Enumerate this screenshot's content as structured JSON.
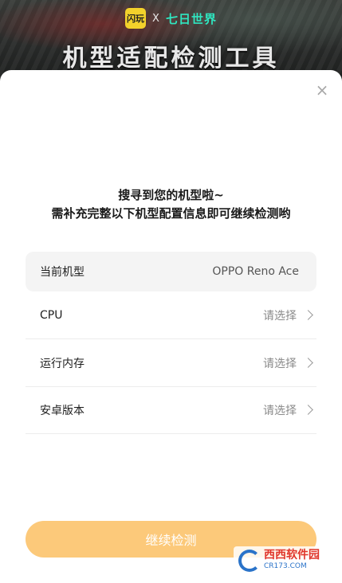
{
  "banner": {
    "brand_logo": "闪玩",
    "brand_x": "X",
    "brand_game": "七日世界",
    "title": "机型适配检测工具"
  },
  "dialog": {
    "close_icon": "×",
    "heading_line1": "搜寻到您的机型啦~",
    "heading_line2": "需补充完整以下机型配置信息即可继续检测哟",
    "device": {
      "label": "当前机型",
      "value": "OPPO Reno Ace"
    },
    "rows": [
      {
        "label": "CPU",
        "placeholder": "请选择"
      },
      {
        "label": "运行内存",
        "placeholder": "请选择"
      },
      {
        "label": "安卓版本",
        "placeholder": "请选择"
      }
    ],
    "continue_label": "继续检测"
  },
  "watermark": {
    "main": "西西软件园",
    "sub": "CR173.COM"
  },
  "colors": {
    "button": "#fcc97a",
    "device_row_bg": "#f4f4f4",
    "brand_game": "#2fe6c0"
  }
}
